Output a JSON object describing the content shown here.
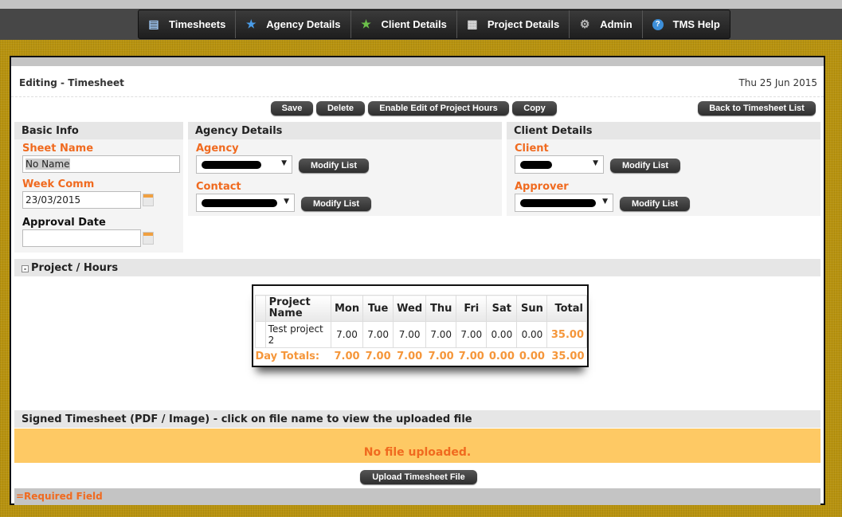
{
  "nav": [
    {
      "label": "Timesheets",
      "icon": "document-icon"
    },
    {
      "label": "Agency Details",
      "icon": "star-blue-icon"
    },
    {
      "label": "Client Details",
      "icon": "star-green-icon"
    },
    {
      "label": "Project Details",
      "icon": "list-icon"
    },
    {
      "label": "Admin",
      "icon": "gears-icon"
    },
    {
      "label": "TMS Help",
      "icon": "help-icon"
    }
  ],
  "header": {
    "title": "Editing - Timesheet",
    "date": "Thu 25 Jun 2015"
  },
  "toolbar": {
    "save": "Save",
    "delete": "Delete",
    "enable_edit": "Enable Edit of Project Hours",
    "copy": "Copy",
    "back": "Back to Timesheet List"
  },
  "basic": {
    "heading": "Basic Info",
    "sheet_name_label": "Sheet Name",
    "sheet_name": "No Name",
    "week_comm_label": "Week Comm",
    "week_comm": "23/03/2015",
    "approval_label": "Approval Date",
    "approval": ""
  },
  "agency": {
    "heading": "Agency Details",
    "agency_label": "Agency",
    "contact_label": "Contact",
    "modify": "Modify List"
  },
  "client": {
    "heading": "Client Details",
    "client_label": "Client",
    "approver_label": "Approver",
    "modify": "Modify List"
  },
  "project": {
    "heading": "Project / Hours",
    "collapse_icon": "minus-box-icon",
    "columns": [
      "Project Name",
      "Mon",
      "Tue",
      "Wed",
      "Thu",
      "Fri",
      "Sat",
      "Sun",
      "Total"
    ],
    "rows": [
      [
        "Test project 2",
        "7.00",
        "7.00",
        "7.00",
        "7.00",
        "7.00",
        "0.00",
        "0.00",
        "35.00"
      ]
    ],
    "totals_label": "Day Totals:",
    "totals": [
      "7.00",
      "7.00",
      "7.00",
      "7.00",
      "7.00",
      "0.00",
      "0.00",
      "35.00"
    ]
  },
  "signed": {
    "heading": "Signed Timesheet (PDF / Image) - click on file name to view the uploaded file",
    "status": "No file uploaded.",
    "upload": "Upload Timesheet File"
  },
  "footer": {
    "required": "=Required Field"
  },
  "colors": {
    "accent": "#f06a1f",
    "total": "#f5963a",
    "nofile_bg": "#fec964"
  }
}
